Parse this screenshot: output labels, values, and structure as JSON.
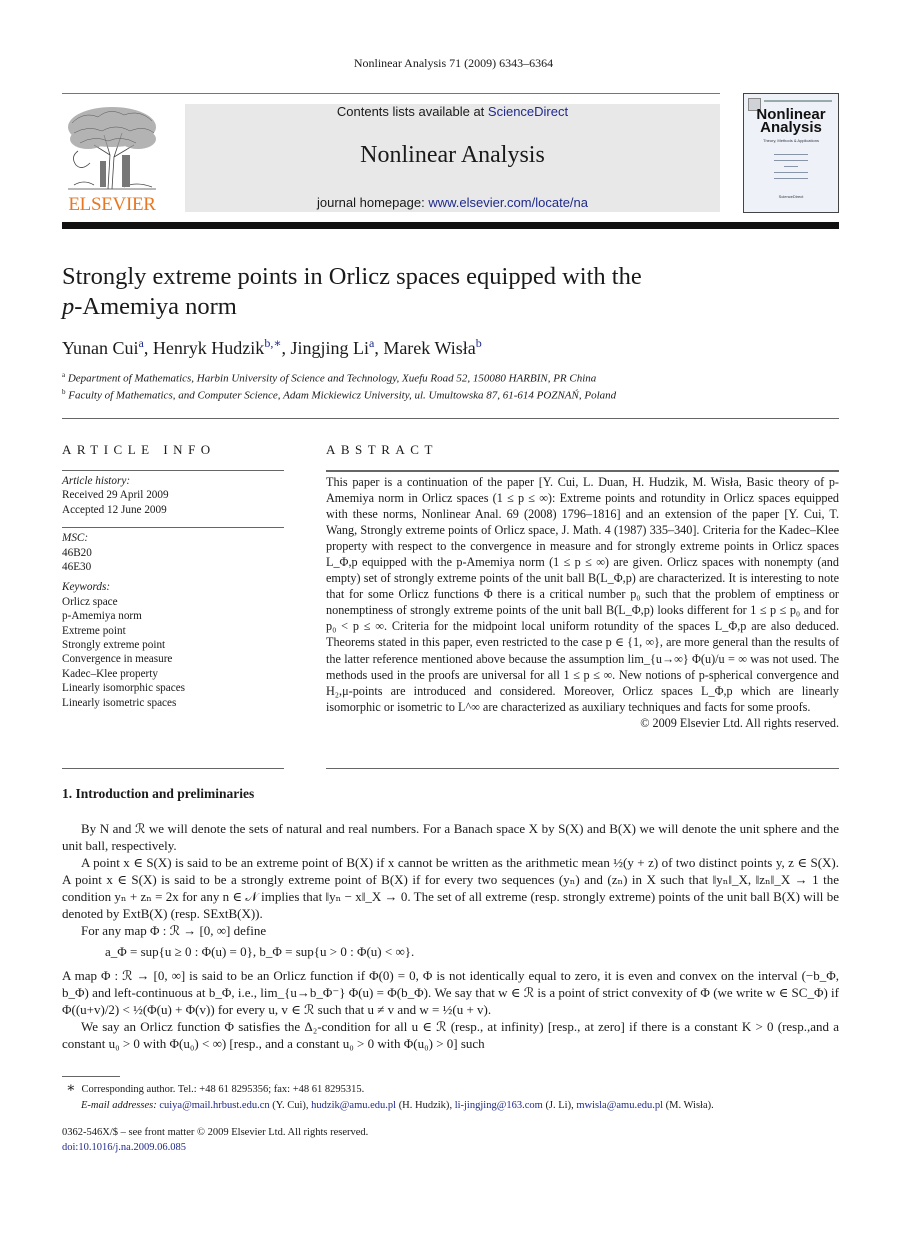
{
  "header": {
    "running_head": "Nonlinear Analysis 71 (2009) 6343–6364",
    "publisher_logo_text": "ELSEVIER",
    "publisher_logo_icon": "elsevier-tree-icon",
    "contents_prefix": "Contents lists available at ",
    "contents_link": "ScienceDirect",
    "journal_name": "Nonlinear Analysis",
    "homepage_prefix": "journal homepage: ",
    "homepage_link": "www.elsevier.com/locate/na",
    "cover": {
      "title_line1": "Nonlinear",
      "title_line2": "Analysis",
      "subtitle": "Theory, Methods & Applications",
      "footer": "ScienceDirect"
    }
  },
  "article": {
    "title_line1": "Strongly extreme points in Orlicz spaces equipped with the",
    "title_line2_italic": "p",
    "title_line2_rest": "-Amemiya norm",
    "authors": [
      {
        "name": "Yunan Cui",
        "sup": "a"
      },
      {
        "name": "Henryk Hudzik",
        "sup": "b,∗"
      },
      {
        "name": "Jingjing Li",
        "sup": "a"
      },
      {
        "name": "Marek Wisła",
        "sup": "b"
      }
    ],
    "affiliations": [
      {
        "sup": "a",
        "text": "Department of Mathematics, Harbin University of Science and Technology, Xuefu Road 52, 150080 HARBIN, PR China"
      },
      {
        "sup": "b",
        "text": "Faculty of Mathematics, and Computer Science, Adam Mickiewicz University, ul. Umultowska 87, 61-614 POZNAŃ, Poland"
      }
    ]
  },
  "article_info": {
    "heading": "ARTICLE INFO",
    "history_label": "Article history:",
    "received": "Received 29 April 2009",
    "accepted": "Accepted 12 June 2009",
    "msc_label": "MSC:",
    "msc": [
      "46B20",
      "46E30"
    ],
    "keywords_label": "Keywords:",
    "keywords": [
      "Orlicz space",
      "p-Amemiya norm",
      "Extreme point",
      "Strongly extreme point",
      "Convergence in measure",
      "Kadec–Klee property",
      "Linearly isomorphic spaces",
      "Linearly isometric spaces"
    ]
  },
  "abstract": {
    "heading": "ABSTRACT",
    "text": "This paper is a continuation of the paper [Y. Cui, L. Duan, H. Hudzik, M. Wisła, Basic theory of p-Amemiya norm in Orlicz spaces (1 ≤ p ≤ ∞): Extreme points and rotundity in Orlicz spaces equipped with these norms, Nonlinear Anal. 69 (2008) 1796–1816] and an extension of the paper [Y. Cui, T. Wang, Strongly extreme points of Orlicz space, J. Math. 4 (1987) 335–340]. Criteria for the Kadec–Klee property with respect to the convergence in measure and for strongly extreme points in Orlicz spaces L_Φ,p equipped with the p-Amemiya norm (1 ≤ p ≤ ∞) are given. Orlicz spaces with nonempty (and empty) set of strongly extreme points of the unit ball B(L_Φ,p) are characterized. It is interesting to note that for some Orlicz functions Φ there is a critical number p₀ such that the problem of emptiness or nonemptiness of strongly extreme points of the unit ball B(L_Φ,p) looks different for 1 ≤ p ≤ p₀ and for p₀ < p ≤ ∞. Criteria for the midpoint local uniform rotundity of the spaces L_Φ,p are also deduced. Theorems stated in this paper, even restricted to the case p ∈ {1, ∞}, are more general than the results of the latter reference mentioned above because the assumption lim_{u→∞} Φ(u)/u = ∞ was not used. The methods used in the proofs are universal for all 1 ≤ p ≤ ∞. New notions of p-spherical convergence and H₂,μ-points are introduced and considered. Moreover, Orlicz spaces L_Φ,p which are linearly isomorphic or isometric to L^∞ are characterized as auxiliary techniques and facts for some proofs.",
    "copyright": "© 2009 Elsevier Ltd. All rights reserved."
  },
  "section1": {
    "heading": "1.  Introduction and preliminaries",
    "p1": "By N and ℛ we will denote the sets of natural and real numbers. For a Banach space X by S(X) and B(X) we will denote the unit sphere and the unit ball, respectively.",
    "p2": "A point x ∈ S(X) is said to be an extreme point of B(X) if x cannot be written as the arithmetic mean ½(y + z) of two distinct points y, z ∈ S(X). A point x ∈ S(X) is said to be a strongly extreme point of B(X) if for every two sequences (yₙ) and (zₙ) in X such that ‖yₙ‖_X, ‖zₙ‖_X → 1 the condition yₙ + zₙ = 2x for any n ∈ 𝒩 implies that ‖yₙ − x‖_X → 0. The set of all extreme (resp. strongly extreme) points of the unit ball B(X) will be denoted by ExtB(X) (resp. SExtB(X)).",
    "p3": "For any map Φ : ℛ → [0, ∞] define",
    "equation": "a_Φ = sup{u ≥ 0 : Φ(u) = 0},        b_Φ = sup{u > 0 : Φ(u) < ∞}.",
    "p4": "A map Φ : ℛ → [0, ∞] is said to be an Orlicz function if Φ(0) = 0, Φ is not identically equal to zero, it is even and convex on the interval (−b_Φ, b_Φ) and left-continuous at b_Φ, i.e., lim_{u→b_Φ⁻} Φ(u) = Φ(b_Φ). We say that w ∈ ℛ is a point of strict convexity of Φ (we write w ∈ SC_Φ) if Φ((u+v)/2) < ½(Φ(u) + Φ(v)) for every u, v ∈ ℛ such that u ≠ v and w = ½(u + v).",
    "p5": "We say an Orlicz function Φ satisfies the Δ₂-condition for all u ∈ ℛ (resp., at infinity) [resp., at zero] if there is a constant K > 0 (resp.,and a constant u₀ > 0 with Φ(u₀) < ∞) [resp., and a constant u₀ > 0 with Φ(u₀) > 0] such"
  },
  "footnotes": {
    "corresponding_mark": "∗",
    "corresponding": "Corresponding author. Tel.: +48 61 8295356; fax: +48 61 8295315.",
    "email_label": "E-mail addresses:",
    "emails": [
      {
        "address": "cuiya@mail.hrbust.edu.cn",
        "who": "(Y. Cui)"
      },
      {
        "address": "hudzik@amu.edu.pl",
        "who": "(H. Hudzik)"
      },
      {
        "address": "li-jingjing@163.com",
        "who": "(J. Li)"
      },
      {
        "address": "mwisla@amu.edu.pl",
        "who": "(M. Wisła)."
      }
    ]
  },
  "frontmatter": {
    "issn_line": "0362-546X/$ – see front matter © 2009 Elsevier Ltd. All rights reserved.",
    "doi": "doi:10.1016/j.na.2009.06.085"
  },
  "colors": {
    "link": "#1f2a8c",
    "elsevier_orange": "#e87722",
    "banner_bg": "#e8e8e8"
  }
}
